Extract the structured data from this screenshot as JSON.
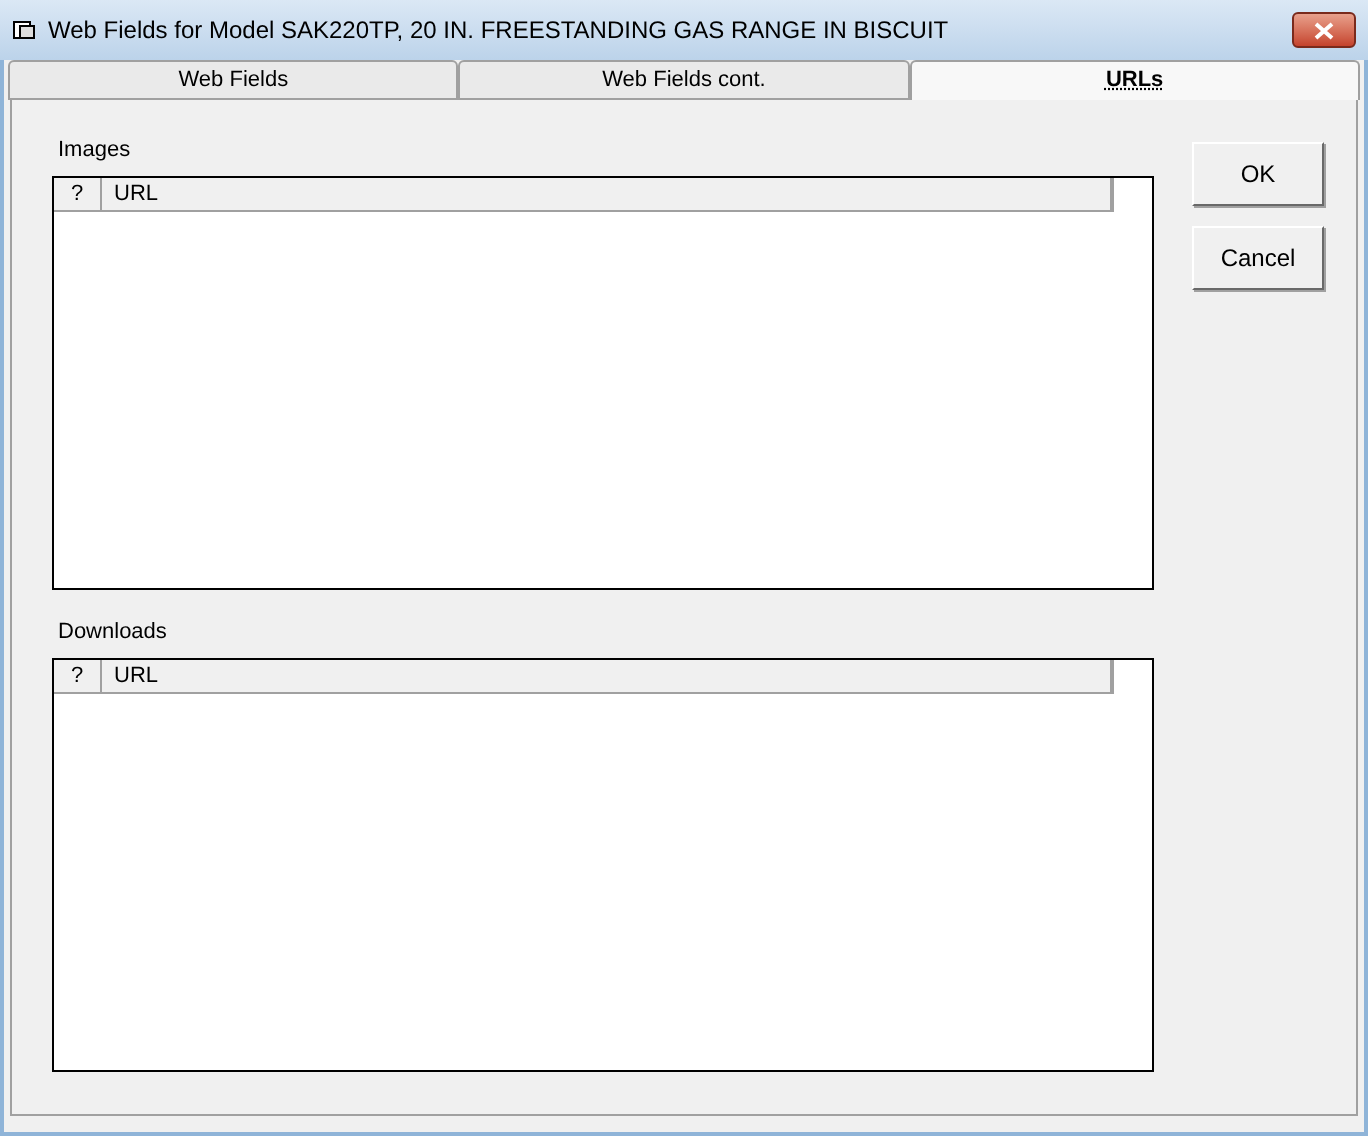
{
  "window": {
    "title": "Web Fields for Model SAK220TP, 20 IN. FREESTANDING GAS RANGE IN BISCUIT"
  },
  "tabs": [
    {
      "label": "Web Fields",
      "selected": false
    },
    {
      "label": "Web Fields cont.",
      "selected": false
    },
    {
      "label": "URLs",
      "selected": true
    }
  ],
  "sections": [
    {
      "label": "Images",
      "columns": [
        "?",
        "URL"
      ]
    },
    {
      "label": "Downloads",
      "columns": [
        "?",
        "URL"
      ]
    }
  ],
  "buttons": [
    "OK",
    "Cancel"
  ]
}
